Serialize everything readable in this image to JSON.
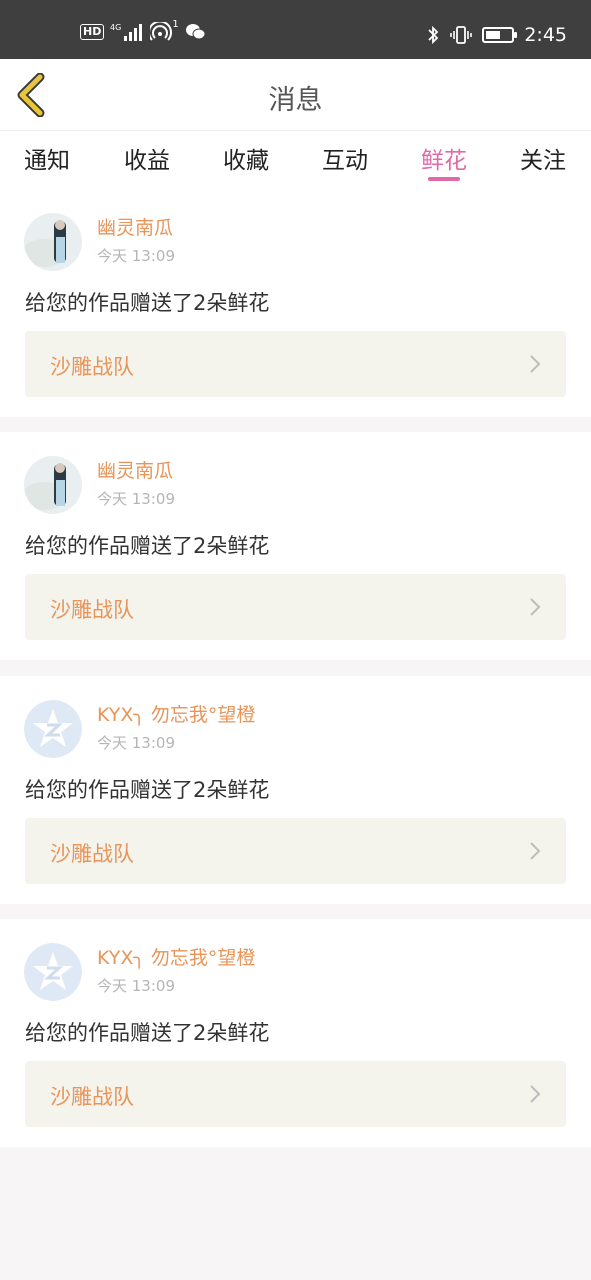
{
  "status_bar": {
    "hd": "HD",
    "network": "4G",
    "notification_count": "1",
    "time": "2:45",
    "battery_level": 0.55
  },
  "header": {
    "title": "消息"
  },
  "tabs": [
    {
      "label": "通知",
      "active": false
    },
    {
      "label": "收益",
      "active": false
    },
    {
      "label": "收藏",
      "active": false
    },
    {
      "label": "互动",
      "active": false
    },
    {
      "label": "鲜花",
      "active": true
    },
    {
      "label": "关注",
      "active": false
    }
  ],
  "notifications": [
    {
      "username": "幽灵南瓜",
      "time": "今天 13:09",
      "message": "给您的作品赠送了2朵鲜花",
      "work": "沙雕战队",
      "avatar": "photo-avatar-icon"
    },
    {
      "username": "幽灵南瓜",
      "time": "今天 13:09",
      "message": "给您的作品赠送了2朵鲜花",
      "work": "沙雕战队",
      "avatar": "photo-avatar-icon"
    },
    {
      "username": "KYX╮ 勿忘我°望橙",
      "time": "今天 13:09",
      "message": "给您的作品赠送了2朵鲜花",
      "work": "沙雕战队",
      "avatar": "qq-star-avatar-icon"
    },
    {
      "username": "KYX╮ 勿忘我°望橙",
      "time": "今天 13:09",
      "message": "给您的作品赠送了2朵鲜花",
      "work": "沙雕战队",
      "avatar": "qq-star-avatar-icon"
    }
  ],
  "colors": {
    "accent_pink": "#e06aa8",
    "username_orange": "#e8955a",
    "back_arrow_yellow": "#e8c53a"
  }
}
